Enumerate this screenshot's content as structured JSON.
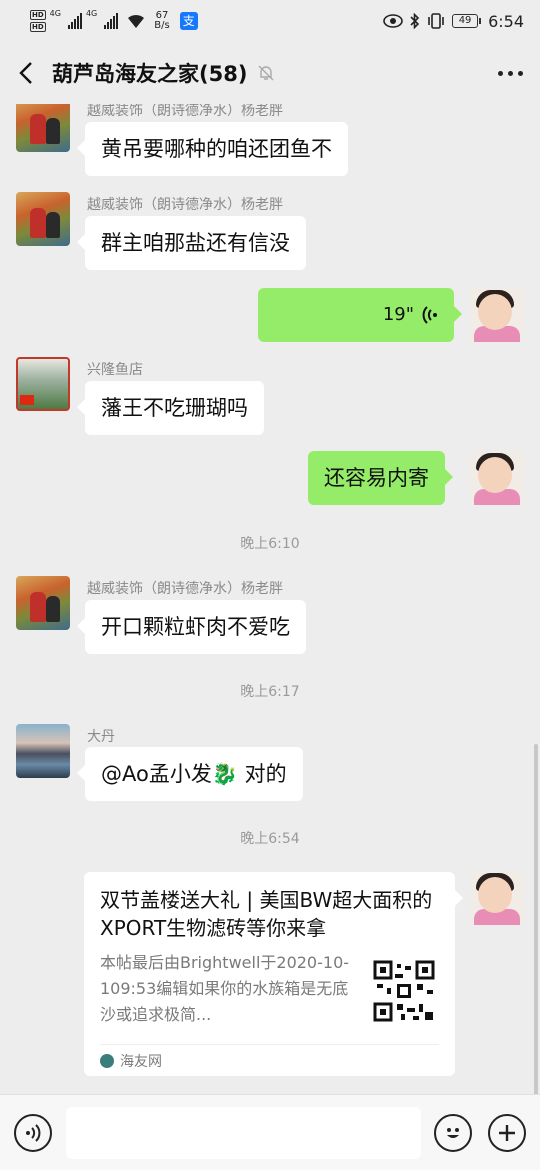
{
  "status_bar": {
    "hd1": "HD",
    "hd2": "HD",
    "sig1": "4G",
    "sig2": "4G",
    "net_speed": "67",
    "net_unit": "B/s",
    "battery": "49",
    "time": "6:54"
  },
  "header": {
    "title": "葫芦岛海友之家(58)"
  },
  "messages": [
    {
      "sender": "越威装饰（朗诗德净水）杨老胖",
      "text": "黄吊要哪种的咱还团鱼不"
    },
    {
      "sender": "越威装饰（朗诗德净水）杨老胖",
      "text": "群主咱那盐还有信没"
    },
    {
      "voice_duration": "19\""
    },
    {
      "sender": "兴隆鱼店",
      "text": "藩王不吃珊瑚吗"
    },
    {
      "text": "还容易内寄"
    },
    {
      "sender": "越威装饰（朗诗德净水）杨老胖",
      "text": "开口颗粒虾肉不爱吃"
    },
    {
      "sender": "大丹",
      "text": "@Ao孟小发🐉 对的"
    }
  ],
  "timestamps": [
    "晚上6:10",
    "晚上6:17",
    "晚上6:54"
  ],
  "link_card": {
    "title": "双节盖楼送大礼 | 美国BW超大面积的XPORT生物滤砖等你来拿",
    "desc": "本帖最后由Brightwell于2020-10-109:53编辑如果你的水族箱是无底沙或追求极简...",
    "source": "海友网"
  },
  "colors": {
    "background": "#ededed",
    "my_bubble": "#95ec69",
    "their_bubble": "#ffffff"
  }
}
